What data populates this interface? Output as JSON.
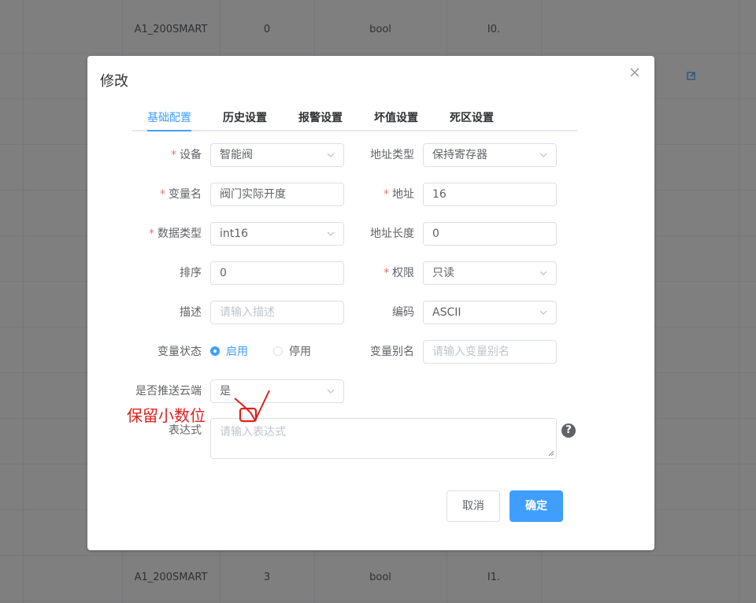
{
  "background": {
    "rows": [
      {
        "device": "A1_200SMART",
        "addr": "0",
        "type": "bool",
        "io": "I0."
      },
      {
        "device": "A1_200SMART",
        "addr": "3",
        "type": "bool",
        "io": "I1."
      }
    ]
  },
  "dialog": {
    "title": "修改",
    "tabs": [
      "基础配置",
      "历史设置",
      "报警设置",
      "坏值设置",
      "死区设置"
    ],
    "active_tab": "基础配置",
    "form": {
      "device": {
        "label": "设备",
        "value": "智能阀",
        "required": "*"
      },
      "address_type": {
        "label": "地址类型",
        "value": "保持寄存器"
      },
      "variable_name": {
        "label": "变量名",
        "value": "阀门实际开度",
        "required": "*"
      },
      "address": {
        "label": "地址",
        "value": "16",
        "required": "*"
      },
      "data_type": {
        "label": "数据类型",
        "value": "int16",
        "required": "*"
      },
      "address_length": {
        "label": "地址长度",
        "value": "0"
      },
      "sort": {
        "label": "排序",
        "value": "0"
      },
      "permission": {
        "label": "权限",
        "value": "只读",
        "required": "*"
      },
      "description": {
        "label": "描述",
        "placeholder": "请输入描述"
      },
      "encoding": {
        "label": "编码",
        "value": "ASCII"
      },
      "variable_status": {
        "label": "变量状态",
        "options": [
          "启用",
          "停用"
        ],
        "selected": "启用"
      },
      "variable_alias": {
        "label": "变量别名",
        "placeholder": "请输入变量别名"
      },
      "push_cloud": {
        "label": "是否推送云端",
        "value": "是"
      },
      "expression": {
        "label": "表达式",
        "placeholder": "请输入表达式"
      }
    },
    "buttons": {
      "cancel": "取消",
      "confirm": "确定"
    },
    "help_icon": "?"
  },
  "annotation": {
    "text": "保留小数位",
    "color": "#e02020"
  },
  "colors": {
    "primary": "#409eff",
    "required": "#f56c6c"
  }
}
